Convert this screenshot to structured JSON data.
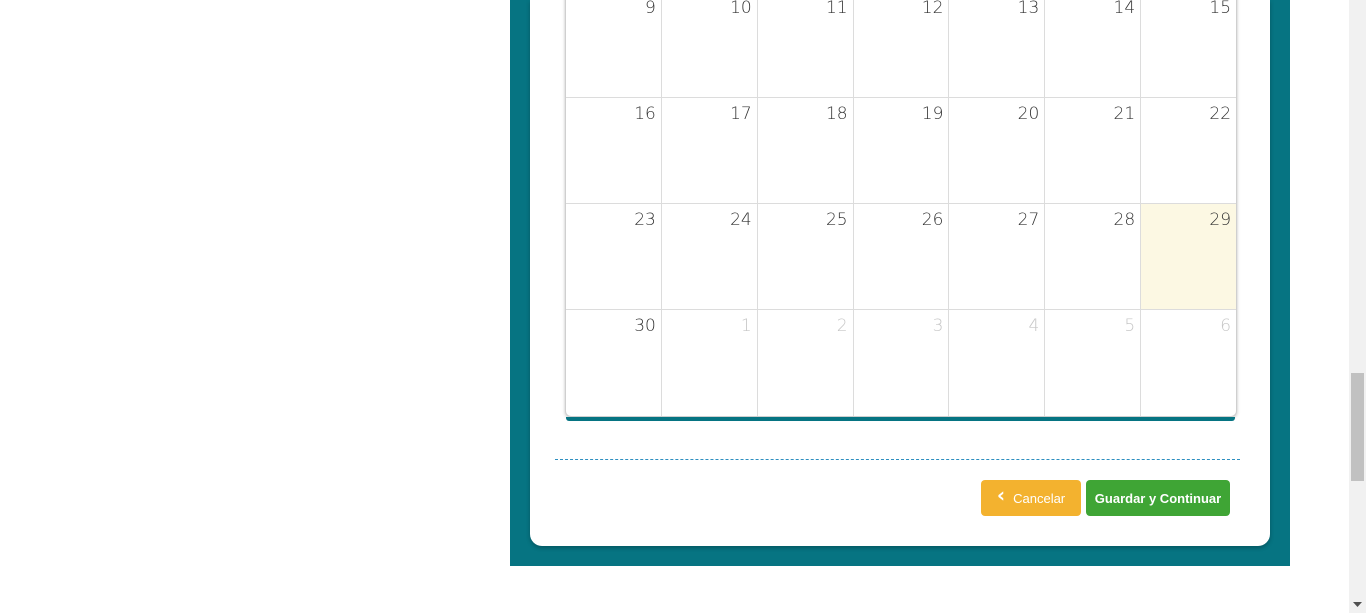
{
  "calendar": {
    "today": "29",
    "weeks": [
      [
        {
          "day": "9"
        },
        {
          "day": "10"
        },
        {
          "day": "11"
        },
        {
          "day": "12"
        },
        {
          "day": "13"
        },
        {
          "day": "14"
        },
        {
          "day": "15"
        }
      ],
      [
        {
          "day": "16"
        },
        {
          "day": "17"
        },
        {
          "day": "18"
        },
        {
          "day": "19"
        },
        {
          "day": "20"
        },
        {
          "day": "21"
        },
        {
          "day": "22"
        }
      ],
      [
        {
          "day": "23"
        },
        {
          "day": "24"
        },
        {
          "day": "25"
        },
        {
          "day": "26"
        },
        {
          "day": "27"
        },
        {
          "day": "28"
        },
        {
          "day": "29",
          "today": true
        }
      ],
      [
        {
          "day": "30"
        },
        {
          "day": "1",
          "other": true
        },
        {
          "day": "2",
          "other": true
        },
        {
          "day": "3",
          "other": true
        },
        {
          "day": "4",
          "other": true
        },
        {
          "day": "5",
          "other": true
        },
        {
          "day": "6",
          "other": true
        }
      ]
    ]
  },
  "actions": {
    "cancel_label": "Cancelar",
    "cancel_icon": "chevron-left-icon",
    "save_label": "Guardar y Continuar"
  },
  "colors": {
    "panel": "#067482",
    "today_bg": "#fcf8e3",
    "cancel": "#f3b22f",
    "save": "#3fa535",
    "divider": "#2e8fc0"
  }
}
